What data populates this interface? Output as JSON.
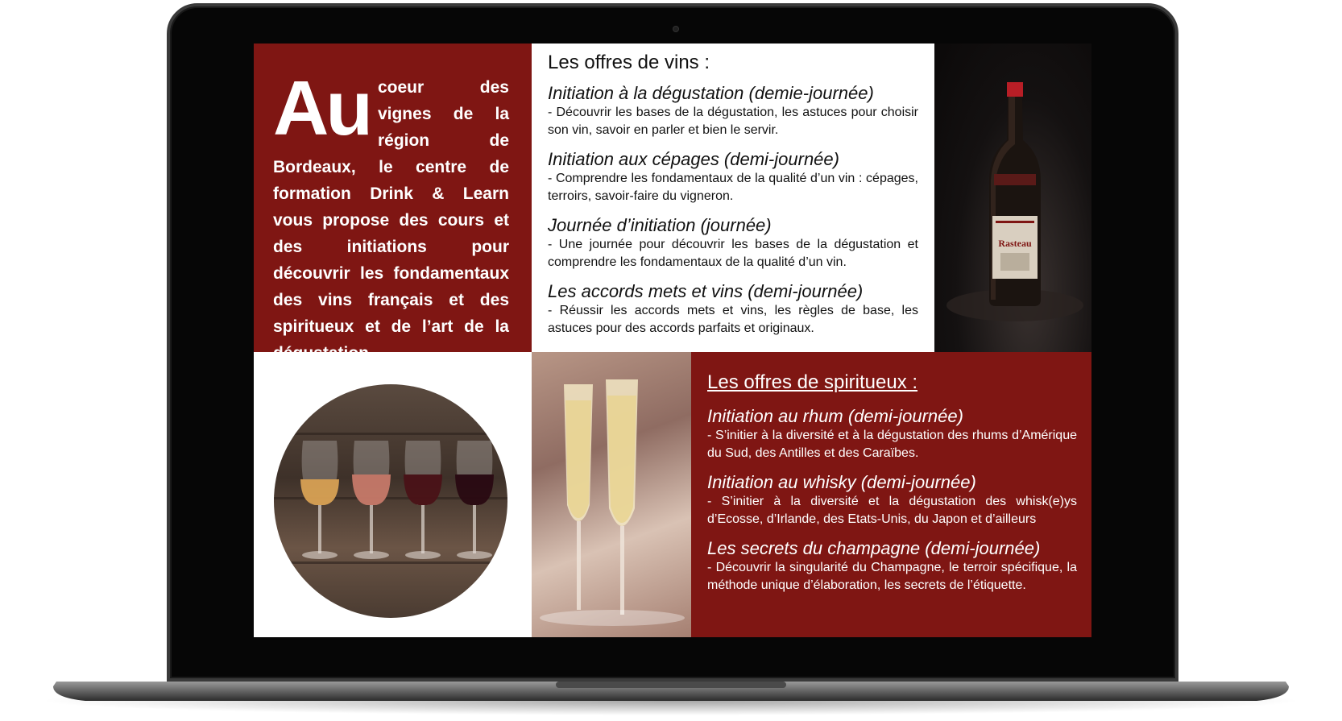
{
  "intro": {
    "dropcap": "Au",
    "text": "coeur des vignes de la région de Bordeaux, le centre de formation Drink & Learn vous propose des cours et des initiations pour découvrir les fondamentaux des vins français et des spiritueux et de l’art de la dégustation"
  },
  "wine": {
    "title": "Les offres de vins :",
    "offers": [
      {
        "title": "Initiation à la dégustation (demie-journée)",
        "desc": "- Découvrir les bases de la dégustation, les astuces pour choisir son vin, savoir en parler et bien le servir."
      },
      {
        "title": "Initiation aux cépages (demi-journée)",
        "desc": "- Comprendre les fondamentaux de la qualité d’un vin : cépages, terroirs, savoir-faire du vigneron."
      },
      {
        "title": "Journée d’initiation (journée)",
        "desc": "- Une journée pour découvrir les bases de la dégustation et comprendre les fondamentaux de la qualité d’un vin."
      },
      {
        "title": "Les accords mets et vins (demi-journée)",
        "desc": "- Réussir les accords mets et vins, les règles de base, les astuces pour des accords parfaits et originaux."
      }
    ]
  },
  "bottle": {
    "label_brand": "Rasteau"
  },
  "spirits": {
    "title": "Les offres de spiritueux :",
    "offers": [
      {
        "title": "Initiation au rhum (demi-journée)",
        "desc": "- S’initier à la diversité et à la dégustation des rhums d’Amérique du Sud, des Antilles et des Caraïbes."
      },
      {
        "title": "Initiation au whisky (demi-journée)",
        "desc": "- S’initier à la diversité et la dégustation des whisk(e)ys d’Ecosse, d’Irlande, des Etats-Unis, du Japon et d’ailleurs"
      },
      {
        "title": "Les secrets du champagne (demi-journée)",
        "desc": "- Découvrir la singularité du Champagne, le terroir spécifique, la méthode unique d’élaboration, les secrets de l’étiquette."
      }
    ]
  },
  "colors": {
    "brand_red": "#7f1613",
    "laptop_frame": "#3a3a3a"
  }
}
